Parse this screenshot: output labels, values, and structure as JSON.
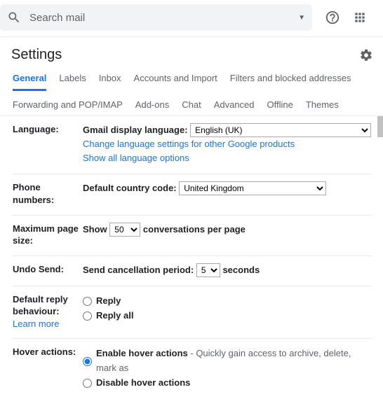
{
  "search": {
    "placeholder": "Search mail"
  },
  "header": {
    "title": "Settings"
  },
  "tabs": [
    "General",
    "Labels",
    "Inbox",
    "Accounts and Import",
    "Filters and blocked addresses",
    "Forwarding and POP/IMAP",
    "Add-ons",
    "Chat",
    "Advanced",
    "Offline",
    "Themes"
  ],
  "language": {
    "label": "Language:",
    "display_label": "Gmail display language:",
    "selected": "English (UK)",
    "change_link": "Change language settings for other Google products",
    "show_all_link": "Show all language options"
  },
  "phone": {
    "label": "Phone numbers:",
    "code_label": "Default country code:",
    "selected": "United Kingdom"
  },
  "pagesize": {
    "label": "Maximum page size:",
    "prefix": "Show",
    "value": "50",
    "suffix": "conversations per page"
  },
  "undo": {
    "label": "Undo Send:",
    "prefix": "Send cancellation period:",
    "value": "5",
    "suffix": "seconds"
  },
  "reply": {
    "label": "Default reply behaviour:",
    "learn": "Learn more",
    "opt1": "Reply",
    "opt2": "Reply all"
  },
  "hover": {
    "label": "Hover actions:",
    "opt1": "Enable hover actions",
    "opt1_desc": " - Quickly gain access to archive, delete, mark as",
    "opt2": "Disable hover actions"
  }
}
